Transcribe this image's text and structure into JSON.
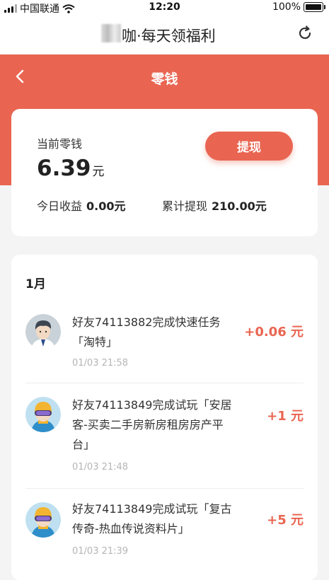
{
  "status_bar": {
    "carrier": "中国联通",
    "time": "12:20",
    "battery": "100%"
  },
  "app_title": "咖·每天领福利",
  "page_title": "零钱",
  "balance": {
    "label": "当前零钱",
    "amount": "6.39",
    "unit": "元",
    "withdraw_label": "提现",
    "today_label": "今日收益",
    "today_value": "0.00元",
    "total_label": "累计提现",
    "total_value": "210.00元"
  },
  "records": {
    "month": "1月",
    "items": [
      {
        "text": "好友74113882完成快速任务「淘特」",
        "time": "01/03 21:58",
        "amount": "+0.06 元",
        "avatar": "male-avatar-icon"
      },
      {
        "text": "好友74113849完成试玩「安居客-买卖二手房新房租房房产平台」",
        "time": "01/03 21:48",
        "amount": "+1 元",
        "avatar": "skier-avatar-icon"
      },
      {
        "text": "好友74113849完成试玩「复古传奇-热血传说资料片」",
        "time": "01/03 21:39",
        "amount": "+5 元",
        "avatar": "skier-avatar-icon"
      }
    ]
  },
  "colors": {
    "accent": "#e96551"
  }
}
